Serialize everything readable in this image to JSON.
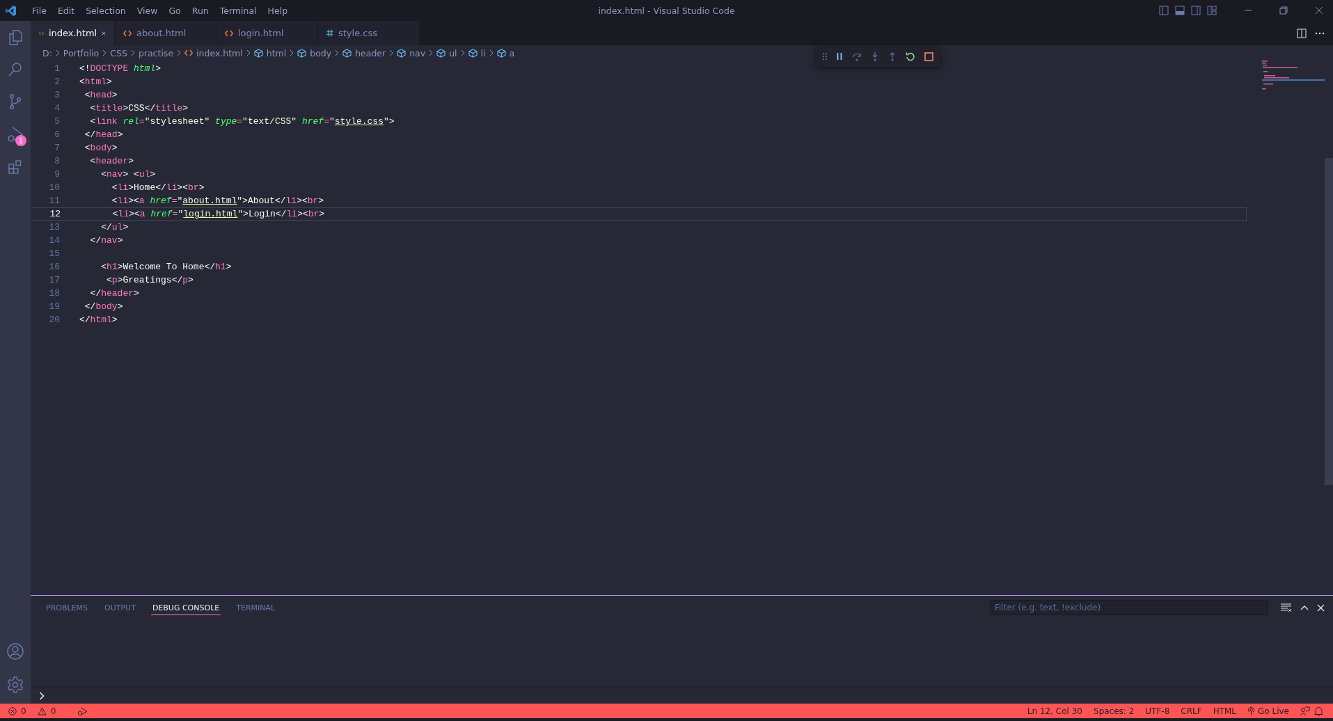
{
  "title_bar": {
    "menu": [
      "File",
      "Edit",
      "Selection",
      "View",
      "Go",
      "Run",
      "Terminal",
      "Help"
    ],
    "title": "index.html - Visual Studio Code"
  },
  "activity_bar": {
    "run_badge": "1"
  },
  "tabs": [
    {
      "label": "index.html",
      "kind": "html",
      "selected": true
    },
    {
      "label": "about.html",
      "kind": "html",
      "selected": false
    },
    {
      "label": "login.html",
      "kind": "html",
      "selected": false
    },
    {
      "label": "style.css",
      "kind": "css",
      "selected": false
    }
  ],
  "breadcrumb": [
    {
      "label": "D:",
      "kind": "folder"
    },
    {
      "label": "Portfolio",
      "kind": "folder"
    },
    {
      "label": "CSS",
      "kind": "folder"
    },
    {
      "label": "practise",
      "kind": "folder"
    },
    {
      "label": "index.html",
      "kind": "file"
    },
    {
      "label": "html",
      "kind": "symbol"
    },
    {
      "label": "body",
      "kind": "symbol"
    },
    {
      "label": "header",
      "kind": "symbol"
    },
    {
      "label": "nav",
      "kind": "symbol"
    },
    {
      "label": "ul",
      "kind": "symbol"
    },
    {
      "label": "li",
      "kind": "symbol"
    },
    {
      "label": "a",
      "kind": "symbol"
    }
  ],
  "editor": {
    "lines": [
      {
        "number": "1",
        "selected": false,
        "tokens": [
          {
            "kind": "punct",
            "text": "<!"
          },
          {
            "kind": "tag",
            "text": "DOCTYPE"
          },
          {
            "kind": "attr",
            "text": " html"
          },
          {
            "kind": "punct",
            "text": ">"
          }
        ]
      },
      {
        "number": "2",
        "selected": false,
        "tokens": [
          {
            "kind": "punct",
            "text": "<"
          },
          {
            "kind": "tag",
            "text": "html"
          },
          {
            "kind": "punct",
            "text": ">"
          }
        ]
      },
      {
        "number": "3",
        "selected": false,
        "tokens": [
          {
            "kind": "punct",
            "text": " <"
          },
          {
            "kind": "tag",
            "text": "head"
          },
          {
            "kind": "punct",
            "text": ">"
          }
        ]
      },
      {
        "number": "4",
        "selected": false,
        "tokens": [
          {
            "kind": "punct",
            "text": "  <"
          },
          {
            "kind": "tag",
            "text": "title"
          },
          {
            "kind": "punct",
            "text": ">CSS</"
          },
          {
            "kind": "tag",
            "text": "title"
          },
          {
            "kind": "punct",
            "text": ">"
          }
        ]
      },
      {
        "number": "5",
        "selected": false,
        "tokens": [
          {
            "kind": "punct",
            "text": "  <"
          },
          {
            "kind": "tag",
            "text": "link"
          },
          {
            "kind": "attr",
            "text": " rel"
          },
          {
            "kind": "tag",
            "text": "="
          },
          {
            "kind": "string",
            "text": "\"stylesheet\""
          },
          {
            "kind": "attr",
            "text": " type"
          },
          {
            "kind": "tag",
            "text": "="
          },
          {
            "kind": "string",
            "text": "\"text/CSS\""
          },
          {
            "kind": "attr",
            "text": " href"
          },
          {
            "kind": "tag",
            "text": "="
          },
          {
            "kind": "string",
            "text": "\""
          },
          {
            "kind": "link",
            "text": "style.css"
          },
          {
            "kind": "string",
            "text": "\""
          },
          {
            "kind": "punct",
            "text": ">"
          }
        ]
      },
      {
        "number": "6",
        "selected": false,
        "tokens": [
          {
            "kind": "punct",
            "text": " </"
          },
          {
            "kind": "tag",
            "text": "head"
          },
          {
            "kind": "punct",
            "text": ">"
          }
        ]
      },
      {
        "number": "7",
        "selected": false,
        "tokens": [
          {
            "kind": "punct",
            "text": " <"
          },
          {
            "kind": "tag",
            "text": "body"
          },
          {
            "kind": "punct",
            "text": ">"
          }
        ]
      },
      {
        "number": "8",
        "selected": false,
        "tokens": [
          {
            "kind": "punct",
            "text": "  <"
          },
          {
            "kind": "tag",
            "text": "header"
          },
          {
            "kind": "punct",
            "text": ">"
          }
        ]
      },
      {
        "number": "9",
        "selected": false,
        "tokens": [
          {
            "kind": "punct",
            "text": "    <"
          },
          {
            "kind": "tag",
            "text": "nav"
          },
          {
            "kind": "punct",
            "text": "> <"
          },
          {
            "kind": "tag",
            "text": "ul"
          },
          {
            "kind": "punct",
            "text": ">"
          }
        ]
      },
      {
        "number": "10",
        "selected": false,
        "tokens": [
          {
            "kind": "punct",
            "text": "      <"
          },
          {
            "kind": "tag",
            "text": "li"
          },
          {
            "kind": "punct",
            "text": ">Home</"
          },
          {
            "kind": "tag",
            "text": "li"
          },
          {
            "kind": "punct",
            "text": "><"
          },
          {
            "kind": "tag",
            "text": "br"
          },
          {
            "kind": "punct",
            "text": ">"
          }
        ]
      },
      {
        "number": "11",
        "selected": false,
        "tokens": [
          {
            "kind": "punct",
            "text": "      <"
          },
          {
            "kind": "tag",
            "text": "li"
          },
          {
            "kind": "punct",
            "text": "><"
          },
          {
            "kind": "tag",
            "text": "a"
          },
          {
            "kind": "attr",
            "text": " href"
          },
          {
            "kind": "tag",
            "text": "="
          },
          {
            "kind": "string",
            "text": "\""
          },
          {
            "kind": "link",
            "text": "about.html"
          },
          {
            "kind": "string",
            "text": "\""
          },
          {
            "kind": "punct",
            "text": ">About</"
          },
          {
            "kind": "tag",
            "text": "li"
          },
          {
            "kind": "punct",
            "text": "><"
          },
          {
            "kind": "tag",
            "text": "br"
          },
          {
            "kind": "punct",
            "text": ">"
          }
        ]
      },
      {
        "number": "12",
        "selected": true,
        "tokens": [
          {
            "kind": "punct",
            "text": "      <"
          },
          {
            "kind": "tag",
            "text": "li"
          },
          {
            "kind": "punct",
            "text": "><"
          },
          {
            "kind": "tag",
            "text": "a"
          },
          {
            "kind": "attr",
            "text": " href"
          },
          {
            "kind": "tag",
            "text": "="
          },
          {
            "kind": "string",
            "text": "\""
          },
          {
            "kind": "link",
            "text": "login.html"
          },
          {
            "kind": "string",
            "text": "\""
          },
          {
            "kind": "punct",
            "text": ">Login</"
          },
          {
            "kind": "tag",
            "text": "li"
          },
          {
            "kind": "punct",
            "text": "><"
          },
          {
            "kind": "tag",
            "text": "br"
          },
          {
            "kind": "punct",
            "text": ">"
          }
        ]
      },
      {
        "number": "13",
        "selected": false,
        "tokens": [
          {
            "kind": "punct",
            "text": "    </"
          },
          {
            "kind": "tag",
            "text": "ul"
          },
          {
            "kind": "punct",
            "text": ">"
          }
        ]
      },
      {
        "number": "14",
        "selected": false,
        "tokens": [
          {
            "kind": "punct",
            "text": "  </"
          },
          {
            "kind": "tag",
            "text": "nav"
          },
          {
            "kind": "punct",
            "text": ">"
          }
        ]
      },
      {
        "number": "15",
        "selected": false
      },
      {
        "number": "16",
        "selected": false,
        "tokens": [
          {
            "kind": "punct",
            "text": "    <"
          },
          {
            "kind": "tag",
            "text": "h1"
          },
          {
            "kind": "punct",
            "text": ">Welcome To Home</"
          },
          {
            "kind": "tag",
            "text": "h1"
          },
          {
            "kind": "punct",
            "text": ">"
          }
        ]
      },
      {
        "number": "17",
        "selected": false,
        "tokens": [
          {
            "kind": "punct",
            "text": "     <"
          },
          {
            "kind": "tag",
            "text": "p"
          },
          {
            "kind": "punct",
            "text": ">Greatings</"
          },
          {
            "kind": "tag",
            "text": "p"
          },
          {
            "kind": "punct",
            "text": ">"
          }
        ]
      },
      {
        "number": "18",
        "selected": false,
        "tokens": [
          {
            "kind": "punct",
            "text": "  </"
          },
          {
            "kind": "tag",
            "text": "header"
          },
          {
            "kind": "punct",
            "text": ">"
          }
        ]
      },
      {
        "number": "19",
        "selected": false,
        "tokens": [
          {
            "kind": "punct",
            "text": " </"
          },
          {
            "kind": "tag",
            "text": "body"
          },
          {
            "kind": "punct",
            "text": ">"
          }
        ]
      },
      {
        "number": "20",
        "selected": false,
        "tokens": [
          {
            "kind": "punct",
            "text": "</"
          },
          {
            "kind": "tag",
            "text": "html"
          },
          {
            "kind": "punct",
            "text": ">"
          }
        ]
      }
    ]
  },
  "panel": {
    "tabs": [
      {
        "label": "PROBLEMS",
        "selected": false
      },
      {
        "label": "OUTPUT",
        "selected": false
      },
      {
        "label": "DEBUG CONSOLE",
        "selected": true
      },
      {
        "label": "TERMINAL",
        "selected": false
      }
    ],
    "filter": {
      "placeholder": "Filter (e.g. text, !exclude)"
    }
  },
  "status_bar": {
    "errors": "0",
    "warnings": "0",
    "items": [
      {
        "text": "Ln 12, Col 30",
        "kind": "plain"
      },
      {
        "text": "Spaces: 2",
        "kind": "plain"
      },
      {
        "text": "UTF-8",
        "kind": "plain"
      },
      {
        "text": "CRLF",
        "kind": "plain"
      },
      {
        "text": "HTML",
        "kind": "plain"
      },
      {
        "text": "Go Live",
        "kind": "live"
      }
    ]
  }
}
